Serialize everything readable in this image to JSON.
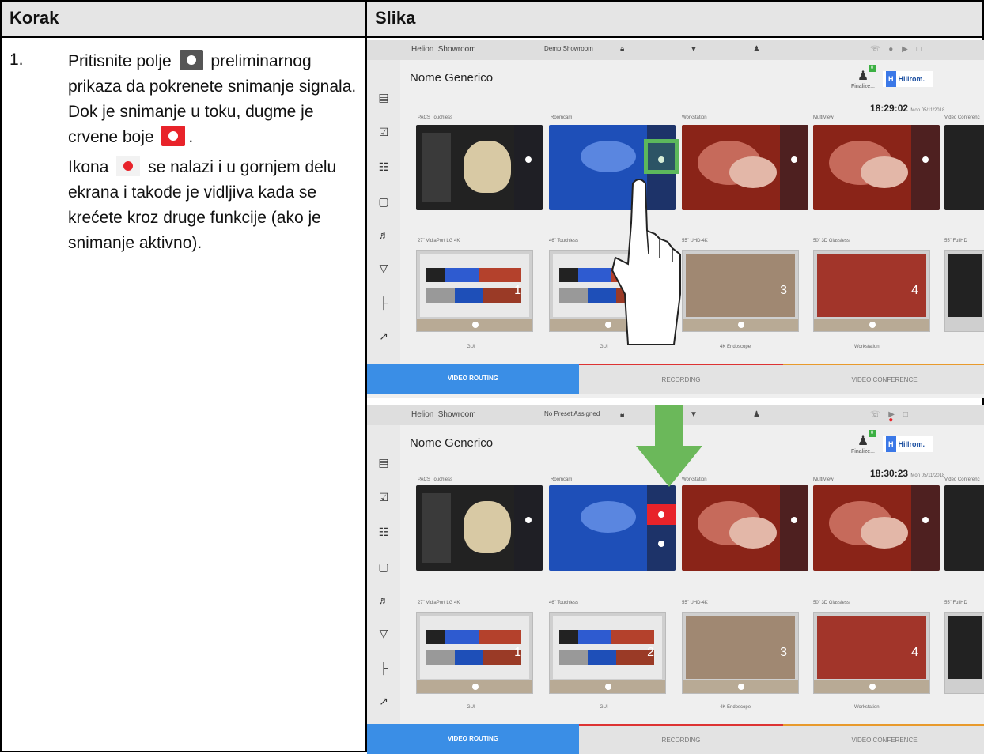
{
  "table": {
    "header_step": "Korak",
    "header_image": "Slika"
  },
  "step": {
    "number": "1.",
    "p1_before": "Pritisnite polje",
    "p1_middle": "preliminarnog prikaza da pokrenete snimanje signala. Dok je snimanje u toku, dugme je crvene boje",
    "p1_end": ".",
    "p2_before": "Ikona",
    "p2_after": "se nalazi i u gornjem delu ekrana i takođe je vidljiva kada se krećete kroz druge funkcije (ako je snimanje aktivno).",
    "icons": [
      "record-gray-button-icon",
      "record-red-button-icon",
      "recording-red-dot-icon"
    ]
  },
  "screens": [
    {
      "title": "Helion |Showroom",
      "preset": "Demo Showroom",
      "patient": "Nome Generico",
      "finalize": "Finalize...",
      "brand": "Hillrom.",
      "brand_mark": "H",
      "badge": "0",
      "time": "18:29:02",
      "date": "Mon 05/11/2018",
      "recording": false,
      "sources": [
        "PACS Touchless",
        "Roomcam",
        "Workstation",
        "MultiView",
        "Video Conferenc"
      ],
      "displays": [
        "27\" VidiaPort LG 4K",
        "46\" Touchless",
        "55\" UHD-4K",
        "50\" 3D Glassless",
        "55\" FullHD"
      ],
      "display_numbers": [
        "1",
        "2",
        "3",
        "4"
      ],
      "assignments": [
        "GUI",
        "GUI",
        "4K Endoscope",
        "Workstation"
      ],
      "tabs": [
        "VIDEO ROUTING",
        "RECORDING",
        "VIDEO CONFERENCE"
      ]
    },
    {
      "title": "Helion |Showroom",
      "preset": "No Preset Assigned",
      "patient": "Nome Generico",
      "finalize": "Finalize...",
      "brand": "Hillrom.",
      "brand_mark": "H",
      "badge": "0",
      "time": "18:30:23",
      "date": "Mon 05/11/2018",
      "recording": true,
      "sources": [
        "PACS Touchless",
        "Roomcam",
        "Workstation",
        "MultiView",
        "Video Conferenc"
      ],
      "displays": [
        "27\" VidiaPort LG 4K",
        "46\" Touchless",
        "55\" UHD-4K",
        "50\" 3D Glassless",
        "55\" FullHD"
      ],
      "display_numbers": [
        "1",
        "2",
        "3",
        "4"
      ],
      "assignments": [
        "GUI",
        "GUI",
        "4K Endoscope",
        "Workstation"
      ],
      "tabs": [
        "VIDEO ROUTING",
        "RECORDING",
        "VIDEO CONFERENCE"
      ]
    }
  ],
  "colors": {
    "record_red": "#e8232a",
    "highlight_green": "#5cb85c",
    "tab_active_blue": "#3a8ee6",
    "header_gray": "#e5e5e5"
  }
}
